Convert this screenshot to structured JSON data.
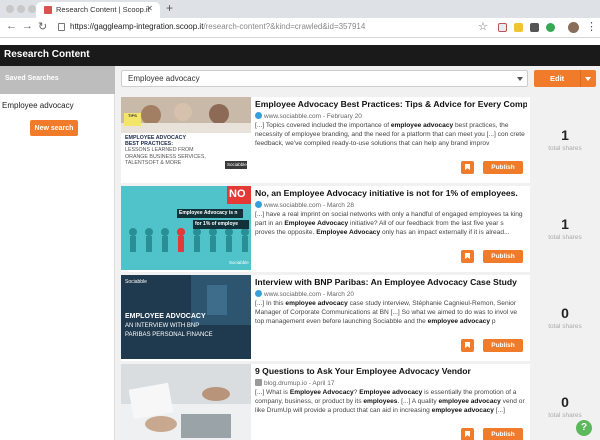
{
  "browser": {
    "tab_title": "Research Content | Scoop.it",
    "url_host": "https://gaggleamp-integration.scoop.it",
    "url_path": "/research-content?&kind=crawled&id=357914"
  },
  "app": {
    "title": "Research Content"
  },
  "sidebar": {
    "saved_searches_label": "Saved Searches",
    "items": [
      {
        "label": "Employee advocacy"
      }
    ],
    "new_search_label": "New search"
  },
  "main": {
    "search_value": "Employee advocacy",
    "edit_label": "Edit",
    "publish_label": "Publish",
    "shares_label": "total shares",
    "cards": [
      {
        "title": "Employee Advocacy Best Practices: Tips & Advice for Every Company",
        "source": "www.sociabble.com",
        "date": "February 20",
        "snippet_html": "[...] Topics covered included the importance of <b>employee advocacy</b> best practices, the necessity of employee branding, and the need for a platform that can meet you [...] con crete feedback, we've compiled ready-to-use solutions that can help any brand improv",
        "shares": "1",
        "thumb_lines": [
          "EMPLOYEE ADVOCACY",
          "BEST PRACTICES:",
          "LESSONS LEARNED FROM",
          "ORANGE BUSINESS SERVICES,",
          "TALENTSOFT & MORE"
        ],
        "thumb_brand": "Sociabble"
      },
      {
        "title": "No, an Employee Advocacy initiative is not for 1% of employees.",
        "source": "www.sociabble.com",
        "date": "March 28",
        "snippet_html": "[...] have a real imprint on social networks with only a handful of engaged employees ta king part in an <b>Employee Advocacy</b> initiative? All of our feedback from the last five year s proves the opposite. <b>Employee Advocacy</b> only has an impact externally if it is alread...",
        "shares": "1",
        "thumb_lines": [
          "NO",
          "Employee Advocacy is n",
          "for 1% of employe"
        ],
        "thumb_brand": "Sociabble"
      },
      {
        "title": "Interview with BNP Paribas: An Employee Advocacy Case Study",
        "source": "www.sociabble.com",
        "date": "March 20",
        "snippet_html": "[...] In this <b>employee advocacy</b> case study interview, Stéphanie Cagnieul-Remon, Senior Manager of Corporate Communications at BN [...] So what we aimed to do was to invol ve top management even before launching Sociabble and the <b>employee advocacy</b> p",
        "shares": "0",
        "thumb_lines": [
          "EMPLOYEE ADVOCACY",
          "AN INTERVIEW WITH BNP",
          "PARIBAS PERSONAL FINANCE"
        ],
        "thumb_brand": "Sociabble"
      },
      {
        "title": "9 Questions to Ask Your Employee Advocacy Vendor",
        "source": "blog.drumup.io",
        "date": "April 17",
        "snippet_html": "[...] What is <b>Employee Advocacy</b>? <b>Employee advocacy</b> is essentially the promotion of a company, business, or product by its <b>employees</b>. [...] A quality <b>employee advocacy</b> vend or like DrumUp will provide a product that can aid in increasing <b>employee advocacy</b> [...]",
        "shares": "0",
        "thumb_lines": [],
        "thumb_brand": ""
      }
    ]
  },
  "colors": {
    "accent": "#f07b2a",
    "header": "#1a1a1a",
    "help": "#5cb85c"
  },
  "icons": {
    "help": "question-icon",
    "bookmark": "bookmark-icon"
  }
}
